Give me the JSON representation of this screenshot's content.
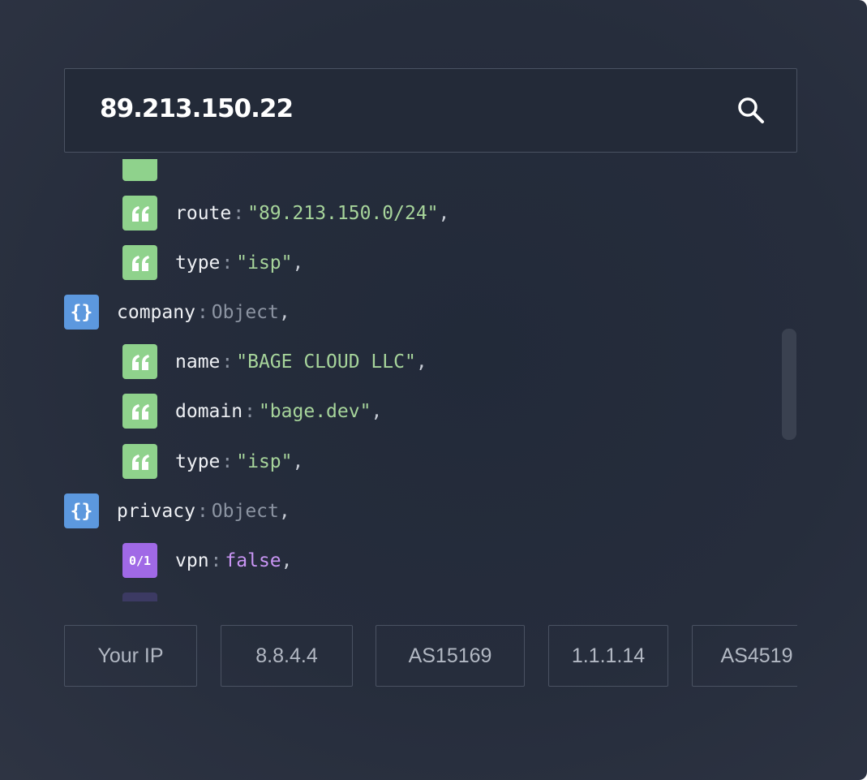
{
  "search": {
    "value": "89.213.150.22"
  },
  "json_rows": [
    {
      "badge": "str",
      "key": "route",
      "value": "\"89.213.150.0/24\""
    },
    {
      "badge": "str",
      "key": "type",
      "value": "\"isp\""
    },
    {
      "badge": "obj",
      "key": "company",
      "value": "Object"
    },
    {
      "badge": "str",
      "key": "name",
      "value": "\"BAGE CLOUD LLC\""
    },
    {
      "badge": "str",
      "key": "domain",
      "value": "\"bage.dev\""
    },
    {
      "badge": "str",
      "key": "type",
      "value": "\"isp\""
    },
    {
      "badge": "obj",
      "key": "privacy",
      "value": "Object"
    },
    {
      "badge": "bool",
      "key": "vpn",
      "value": "false"
    }
  ],
  "symbols": {
    "colon": ":",
    "comma": ",",
    "obj_badge": "{}",
    "bool_badge": "0/1"
  },
  "chips": [
    "Your IP",
    "8.8.4.4",
    "AS15169",
    "1.1.1.14",
    "AS4519"
  ],
  "colors": {
    "string_badge": "#8fd28c",
    "object_badge": "#5c98de",
    "boolean_badge": "#a069e6",
    "string_value": "#a7d59b",
    "boolean_value": "#c995f4"
  }
}
